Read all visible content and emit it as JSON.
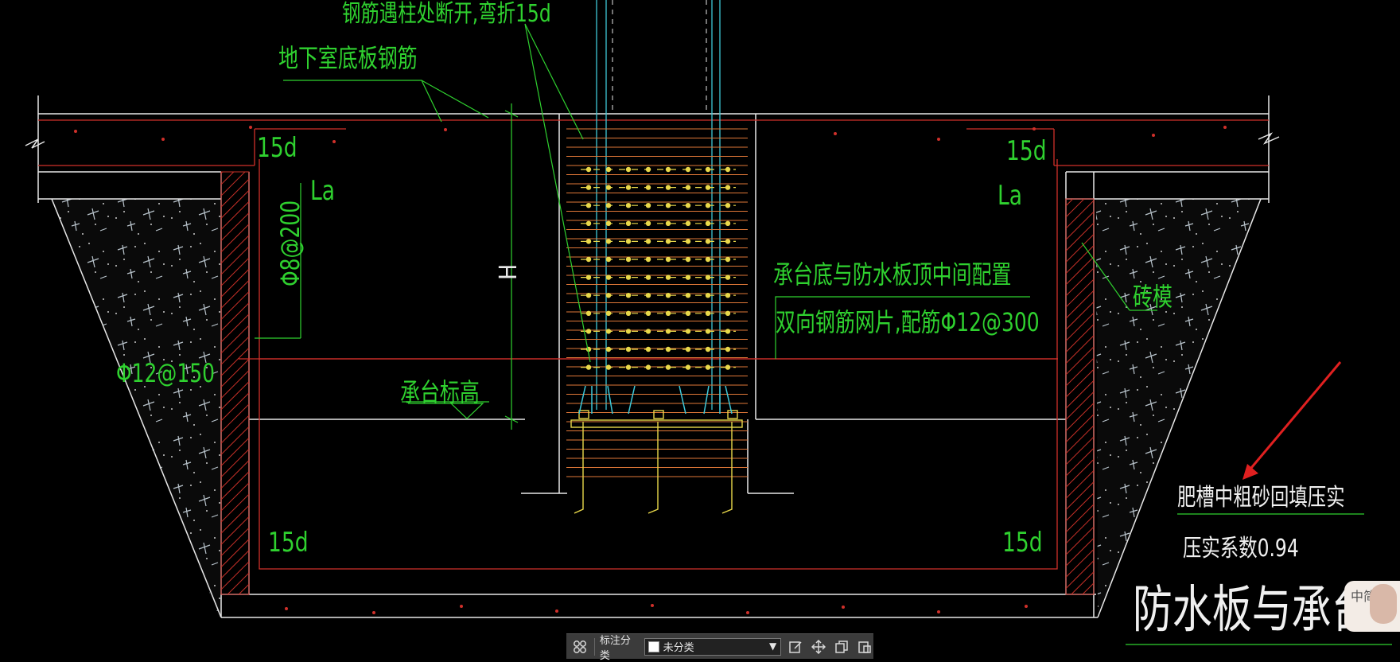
{
  "drawing": {
    "title_partial": "防水板与承台连",
    "labels": {
      "rebar_break": "钢筋遇柱处断开,弯折15d",
      "basement_floor_rebar": "地下室底板钢筋",
      "left_15d_top": "15d",
      "right_15d_top": "15d",
      "left_la": "La",
      "right_la": "La",
      "stirrup": "Φ8@200",
      "left_bar": "Φ12@150",
      "cap_elevation": "承台标高",
      "h_dim": "H",
      "mesh_note_1": "承台底与防水板顶中间配置",
      "mesh_note_2": "双向钢筋网片,配筋Φ12@300",
      "brick_form": "砖模",
      "left_15d_bottom": "15d",
      "right_15d_bottom": "15d"
    },
    "notes": {
      "backfill": "肥槽中粗砂回填压实",
      "compaction": "压实系数0.94"
    },
    "colors": {
      "background": "#000000",
      "label_green": "#2fd12f",
      "outline_white": "#e8e8e8",
      "rebar_red": "#d0302a",
      "column_cyan": "#3fc8d8",
      "bolt_yellow": "#e8d84a",
      "arrow_red": "#e02020"
    }
  },
  "toolbar": {
    "classify_icon": "grid-icon",
    "classify_label": "标注分类",
    "category_value": "未分类",
    "dropdown_icon": "chevron-down-icon",
    "tools": [
      "edit-icon",
      "move-icon",
      "copy-icon",
      "paste-icon"
    ]
  },
  "ime": {
    "text": "中简"
  }
}
